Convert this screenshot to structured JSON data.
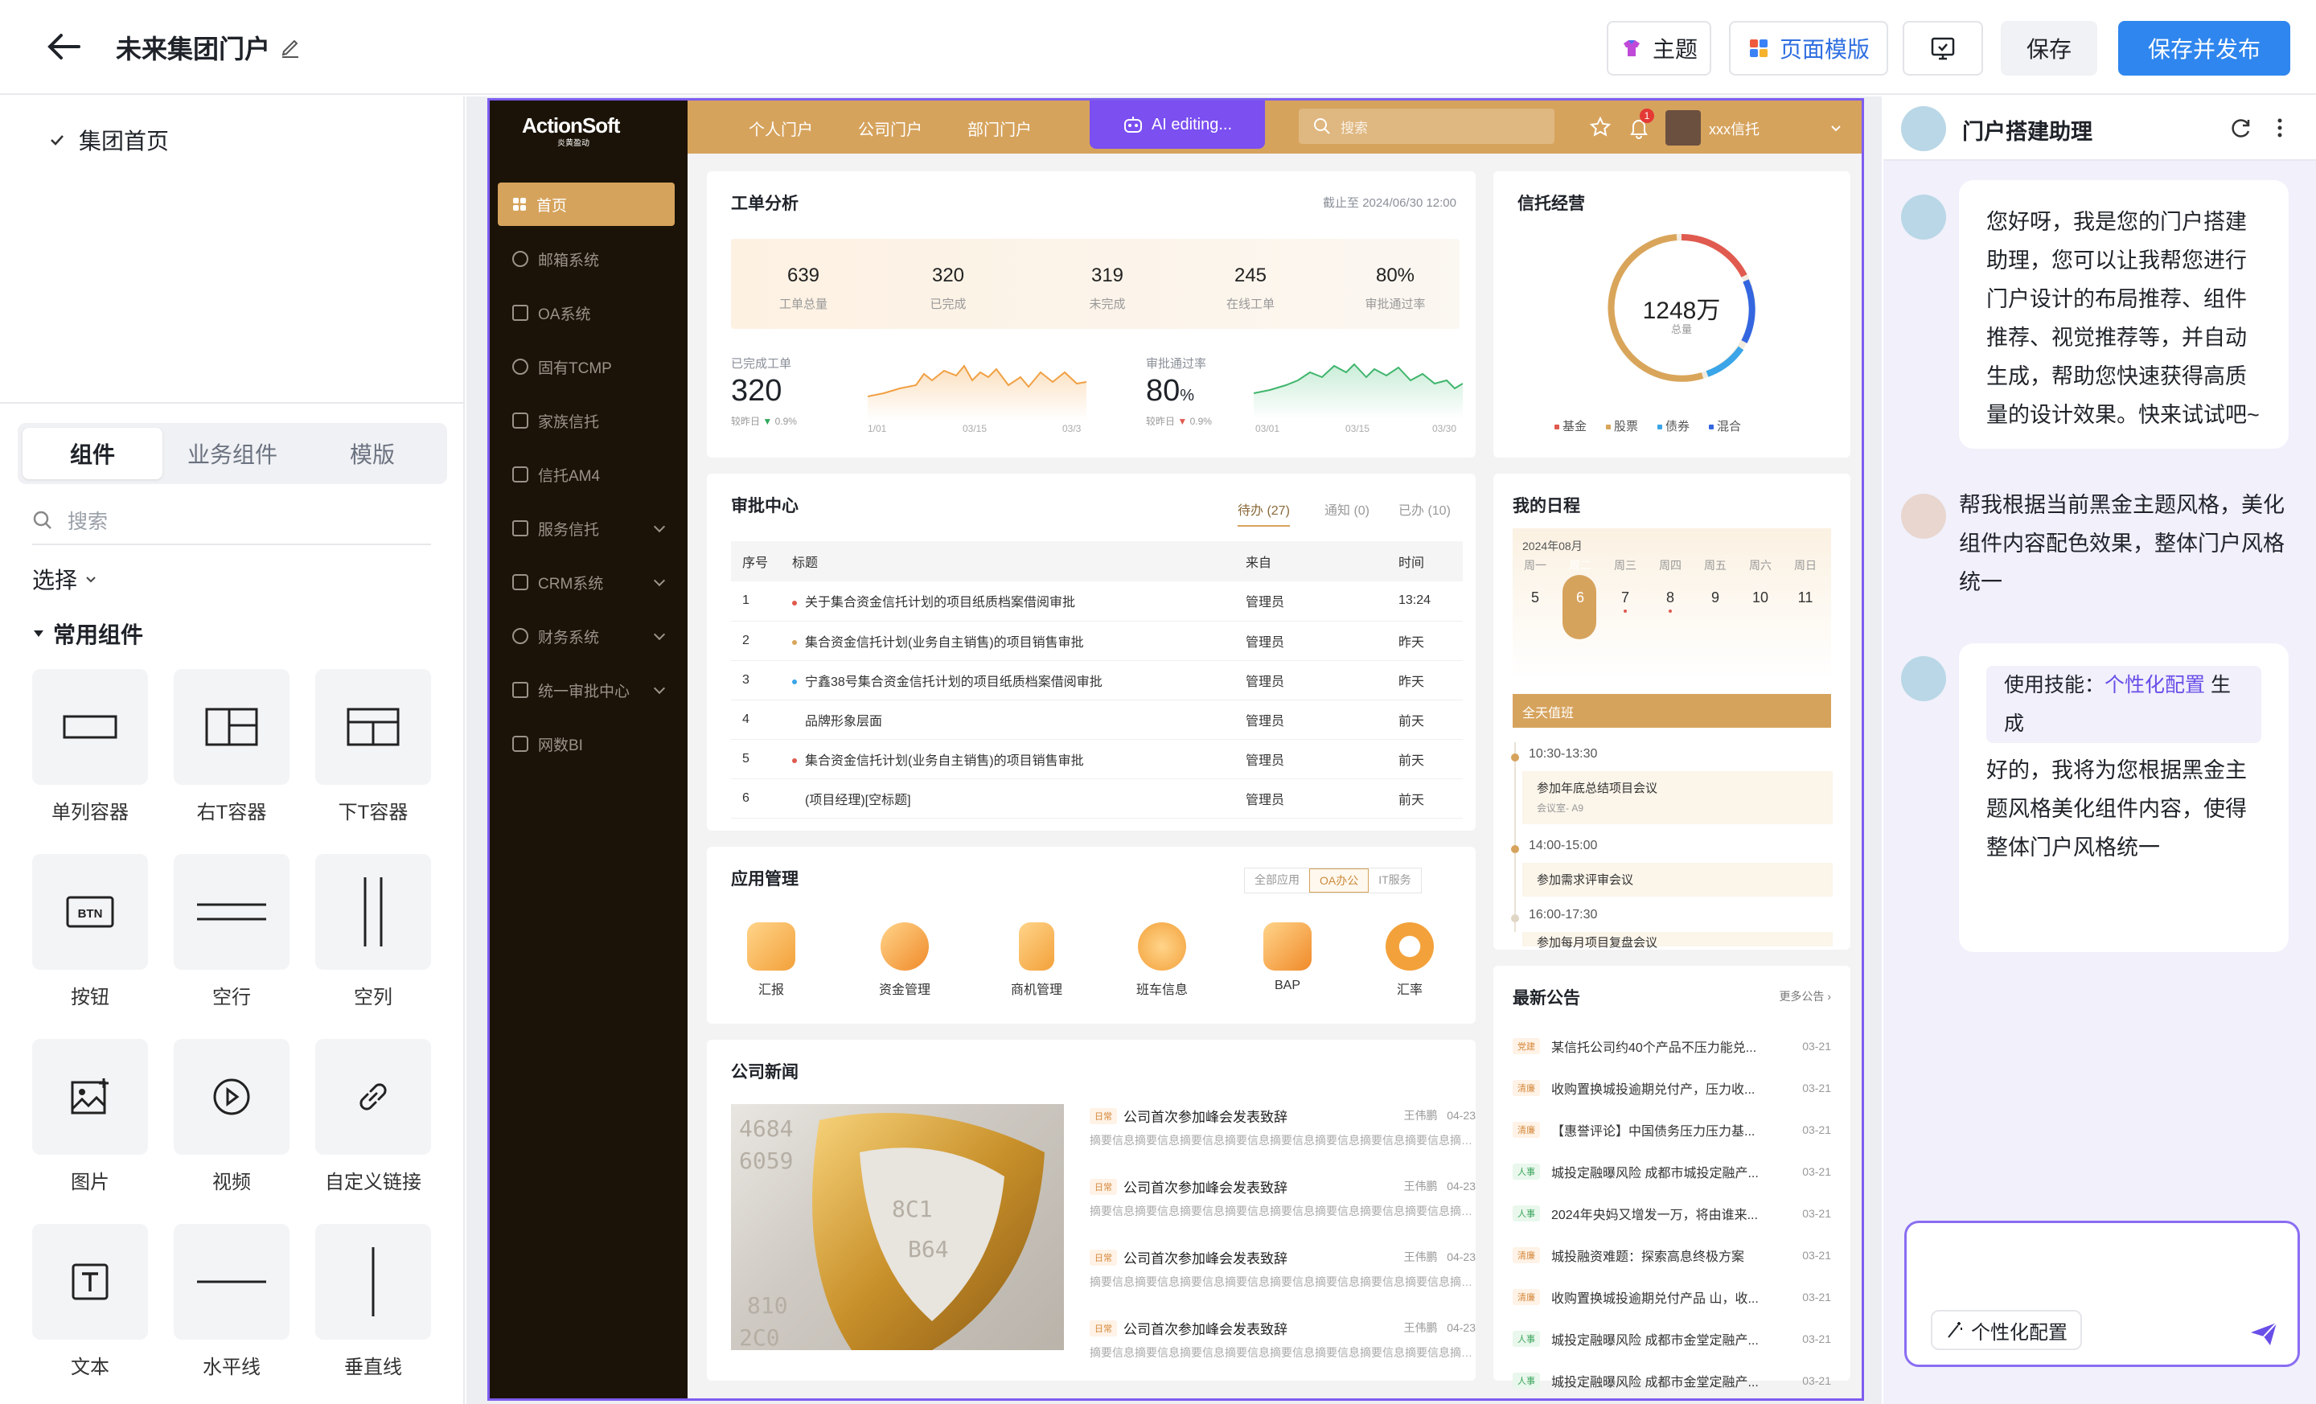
{
  "topbar": {
    "title": "未来集团门户",
    "theme_label": "主题",
    "template_label": "页面模版",
    "save_label": "保存",
    "publish_label": "保存并发布"
  },
  "leftpanel": {
    "page_node": "集团首页",
    "tabs": [
      "组件",
      "业务组件",
      "模版"
    ],
    "search_placeholder": "搜索",
    "select_label": "选择",
    "group_label": "常用组件",
    "components": [
      "单列容器",
      "右T容器",
      "下T容器",
      "按钮",
      "空行",
      "空列",
      "图片",
      "视频",
      "自定义链接",
      "文本",
      "水平线",
      "垂直线"
    ]
  },
  "portal": {
    "logo": "ActionSoft",
    "logo_sub": "炎黄盈动",
    "nav": [
      "个人门户",
      "公司门户",
      "部门门户"
    ],
    "ai_editing": "AI editing...",
    "search_placeholder": "搜索",
    "user_name": "xxx信托",
    "notif_count": "1",
    "sidebar": [
      "首页",
      "邮箱系统",
      "OA系统",
      "固有TCMP",
      "家族信托",
      "信托AM4",
      "服务信托",
      "CRM系统",
      "财务系统",
      "统一审批中心",
      "网数BI"
    ],
    "work": {
      "title": "工单分析",
      "as_of": "截止至 2024/06/30 12:00",
      "stats": [
        {
          "v": "639",
          "l": "工单总量"
        },
        {
          "v": "320",
          "l": "已完成"
        },
        {
          "v": "319",
          "l": "未完成"
        },
        {
          "v": "245",
          "l": "在线工单"
        },
        {
          "v": "80%",
          "l": "审批通过率"
        }
      ],
      "done_label": "已完成工单",
      "done_value": "320",
      "done_cmp": "较昨日",
      "done_delta": "0.9%",
      "rate_label": "审批通过率",
      "rate_value": "80",
      "rate_unit": "%",
      "rate_cmp": "较昨日",
      "rate_delta": "0.9%",
      "axis_left": [
        "1/01",
        "03/15",
        "03/3"
      ],
      "axis_right": [
        "03/01",
        "03/15",
        "03/30"
      ]
    },
    "trust": {
      "title": "信托经营",
      "total": "1248万",
      "total_label": "总量",
      "legend": [
        "基金",
        "股票",
        "债券",
        "混合"
      ],
      "colors": [
        "#e05a4f",
        "#d9a55a",
        "#3aa5e8",
        "#3466e0"
      ]
    },
    "approval": {
      "title": "审批中心",
      "tabs": [
        "待办 (27)",
        "通知 (0)",
        "已办 (10)"
      ],
      "headers": [
        "序号",
        "标题",
        "来自",
        "时间"
      ],
      "rows": [
        {
          "no": "1",
          "title": "关于集合资金信托计划的项目纸质档案借阅审批",
          "from": "管理员",
          "time": "13:24",
          "dot": "#e05a4f"
        },
        {
          "no": "2",
          "title": "集合资金信托计划(业务自主销售)的项目销售审批",
          "from": "管理员",
          "time": "昨天",
          "dot": "#d9a55a"
        },
        {
          "no": "3",
          "title": "宁鑫38号集合资金信托计划的项目纸质档案借阅审批",
          "from": "管理员",
          "time": "昨天",
          "dot": "#3aa5e8"
        },
        {
          "no": "4",
          "title": "品牌形象层面",
          "from": "管理员",
          "time": "前天",
          "dot": ""
        },
        {
          "no": "5",
          "title": "集合资金信托计划(业务自主销售)的项目销售审批",
          "from": "管理员",
          "time": "前天",
          "dot": "#e05a4f"
        },
        {
          "no": "6",
          "title": "(项目经理)[空标题]",
          "from": "管理员",
          "time": "前天",
          "dot": ""
        }
      ]
    },
    "schedule": {
      "title": "我的日程",
      "month": "2024年08月",
      "days": [
        {
          "w": "周一",
          "n": "5"
        },
        {
          "w": "周二",
          "n": "6"
        },
        {
          "w": "周三",
          "n": "7"
        },
        {
          "w": "周四",
          "n": "8"
        },
        {
          "w": "周五",
          "n": "9"
        },
        {
          "w": "周六",
          "n": "10"
        },
        {
          "w": "周日",
          "n": "11"
        }
      ],
      "allday": "全天值班",
      "events": [
        {
          "time": "10:30-13:30",
          "title": "参加年底总结项目会议",
          "room": "会议室- A9"
        },
        {
          "time": "14:00-15:00",
          "title": "参加需求评审会议",
          "room": ""
        },
        {
          "time": "16:00-17:30",
          "title": "参加每月项目复盘会议",
          "room": ""
        }
      ]
    },
    "apps": {
      "title": "应用管理",
      "tabs": [
        "全部应用",
        "OA办公",
        "IT服务"
      ],
      "items": [
        "汇报",
        "资金管理",
        "商机管理",
        "班车信息",
        "BAP",
        "汇率"
      ]
    },
    "news": {
      "title": "公司新闻",
      "items": [
        {
          "tag": "日常",
          "title": "公司首次参加峰会发表致辞",
          "author": "王伟鹏",
          "date": "04-23",
          "desc": "摘要信息摘要信息摘要信息摘要信息摘要信息摘要信息摘要信息摘要信息摘要..."
        },
        {
          "tag": "日常",
          "title": "公司首次参加峰会发表致辞",
          "author": "王伟鹏",
          "date": "04-23",
          "desc": "摘要信息摘要信息摘要信息摘要信息摘要信息摘要信息摘要信息摘要信息摘要..."
        },
        {
          "tag": "日常",
          "title": "公司首次参加峰会发表致辞",
          "author": "王伟鹏",
          "date": "04-23",
          "desc": "摘要信息摘要信息摘要信息摘要信息摘要信息摘要信息摘要信息摘要信息摘要..."
        },
        {
          "tag": "日常",
          "title": "公司首次参加峰会发表致辞",
          "author": "王伟鹏",
          "date": "04-23",
          "desc": "摘要信息摘要信息摘要信息摘要信息摘要信息摘要信息摘要信息摘要信息摘要..."
        }
      ]
    },
    "notices": {
      "title": "最新公告",
      "more": "更多公告",
      "items": [
        {
          "tag": "党建",
          "text": "某信托公司约40个产品不压力能兑...",
          "date": "03-21"
        },
        {
          "tag": "清廉",
          "text": "收购置换城投逾期兑付产，压力收...",
          "date": "03-21"
        },
        {
          "tag": "清廉",
          "text": "【惠誉评论】中国债务压力压力基...",
          "date": "03-21"
        },
        {
          "tag": "人事",
          "text": "城投定融曝风险 成都市城投定融产...",
          "date": "03-21"
        },
        {
          "tag": "人事",
          "text": "2024年央妈又增发一万，将由谁来...",
          "date": "03-21"
        },
        {
          "tag": "清廉",
          "text": "城投融资难题：探索高息终极方案",
          "date": "03-21"
        },
        {
          "tag": "清廉",
          "text": "收购置换城投逾期兑付产品 山，收...",
          "date": "03-21"
        },
        {
          "tag": "人事",
          "text": "城投定融曝风险 成都市金堂定融产...",
          "date": "03-21"
        },
        {
          "tag": "人事",
          "text": "城投定融曝风险 成都市金堂定融产...",
          "date": "03-21"
        }
      ]
    }
  },
  "assistant": {
    "title": "门户搭建助理",
    "msg1": "您好呀，我是您的门户搭建助理，您可以让我帮您进行门户设计的布局推荐、组件推荐、视觉推荐等，并自动生成，帮助您快速获得高质量的设计效果。快来试试吧~",
    "msg2": "帮我根据当前黑金主题风格，美化组件内容配色效果，整体门户风格统一",
    "skill_prefix": "使用技能：",
    "skill_name": "个性化配置",
    "skill_suffix": "生成",
    "msg3": "好的，我将为您根据黑金主题风格美化组件内容，使得整体门户风格统一",
    "chip": "个性化配置"
  }
}
